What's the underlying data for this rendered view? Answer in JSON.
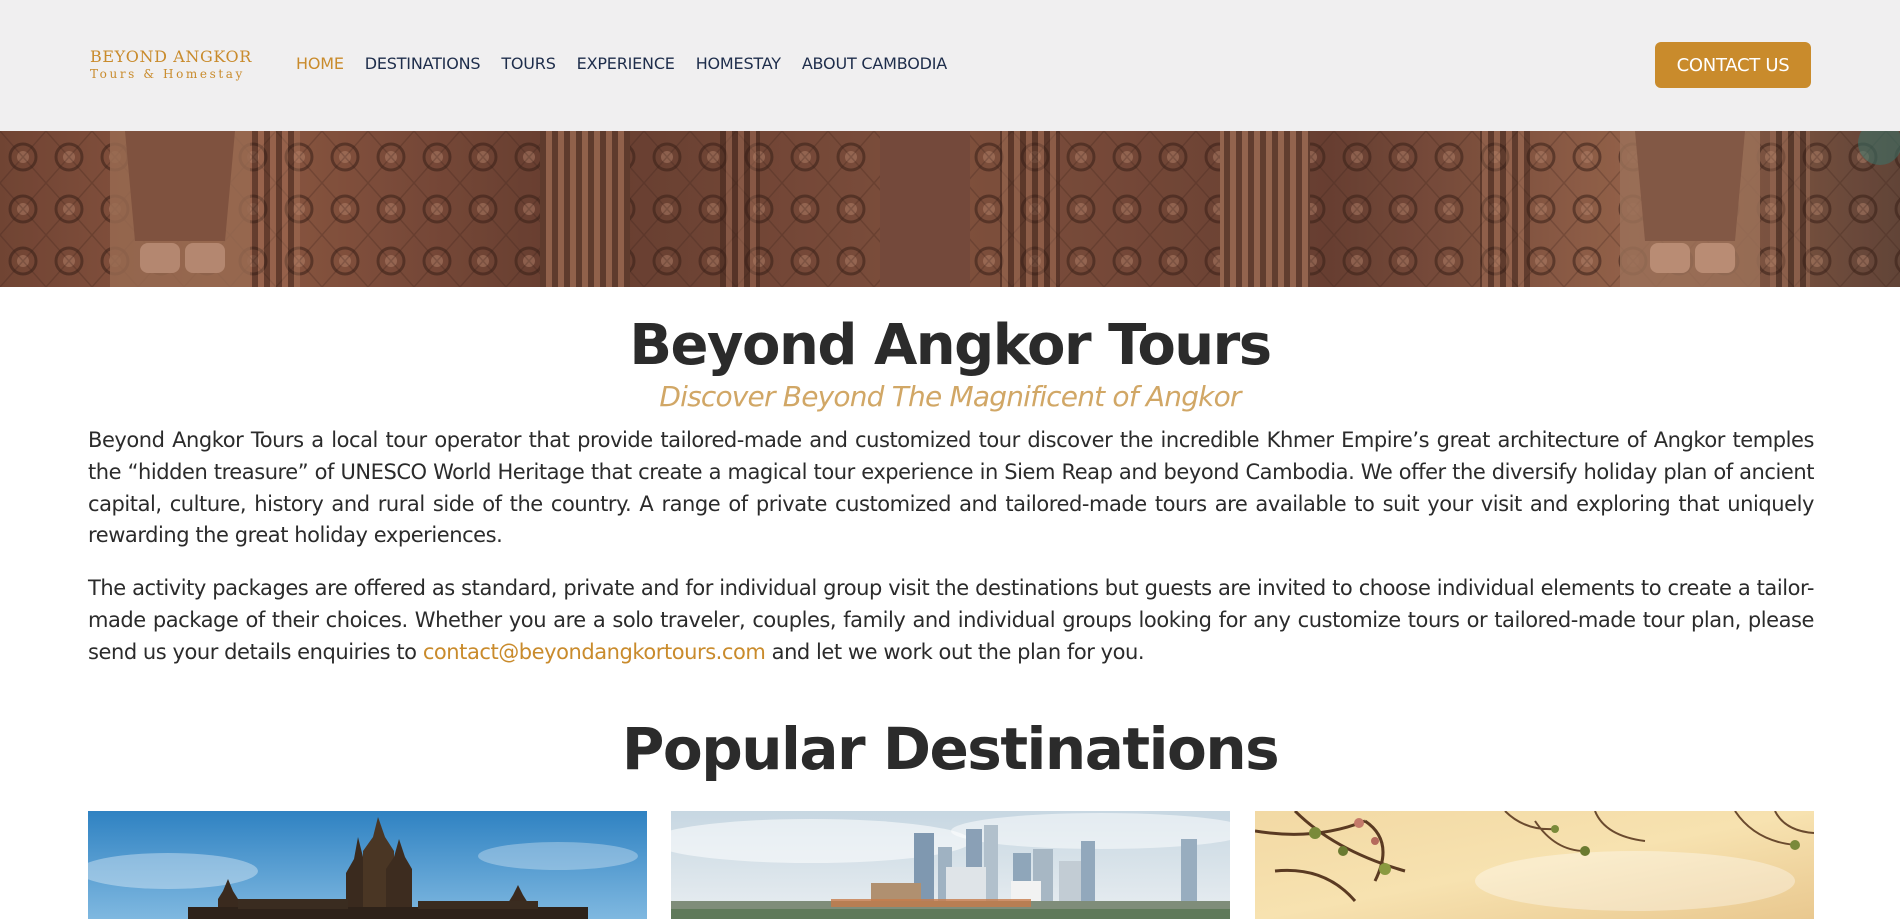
{
  "header": {
    "logo": {
      "name": "BEYOND ANGKOR",
      "tagline": "Tours & Homestay"
    },
    "nav": [
      {
        "label": "HOME",
        "active": true
      },
      {
        "label": "DESTINATIONS",
        "active": false
      },
      {
        "label": "TOURS",
        "active": false
      },
      {
        "label": "EXPERIENCE",
        "active": false
      },
      {
        "label": "HOMESTAY",
        "active": false
      },
      {
        "label": "ABOUT CAMBODIA",
        "active": false
      }
    ],
    "contact_button": "CONTACT US"
  },
  "banner": {
    "image": "carved-temple-wall"
  },
  "intro": {
    "title": "Beyond Angkor Tours",
    "subtitle": "Discover Beyond The Magnificent of Angkor",
    "paragraph1": "Beyond Angkor Tours a local tour operator that provide tailored-made and customized tour discover the incredible Khmer Empire’s great architecture of Angkor temples the “hidden treasure” of UNESCO World Heritage that create a magical tour experience in Siem Reap and beyond Cambodia. We offer the diversify holiday plan of ancient capital, culture, history and rural side of the country. A range of private customized and tailored-made tours are available to suit your visit and exploring that uniquely rewarding the great holiday experiences.",
    "paragraph2_before": "The activity packages are offered as standard, private and for individual group visit the destinations but guests are invited to choose individual elements to create a tailor-made package of their choices. Whether you are a solo traveler, couples, family and individual groups looking for any customize tours or tailored-made tour plan, please send us your details enquiries to ",
    "email": "contact@beyondangkortours.com",
    "paragraph2_after": " and let we work out the plan for you."
  },
  "popular": {
    "title": "Popular Destinations",
    "cards": [
      {
        "image": "angkor-wat-temple-photo"
      },
      {
        "image": "phnom-penh-skyline-photo"
      },
      {
        "image": "tree-branches-sunset-photo"
      }
    ]
  },
  "colors": {
    "accent": "#c98b2c",
    "nav_text": "#1e2d4b",
    "header_bg": "#f0eff0",
    "body_text": "#2b2b2b",
    "subtitle": "#d1a766"
  }
}
